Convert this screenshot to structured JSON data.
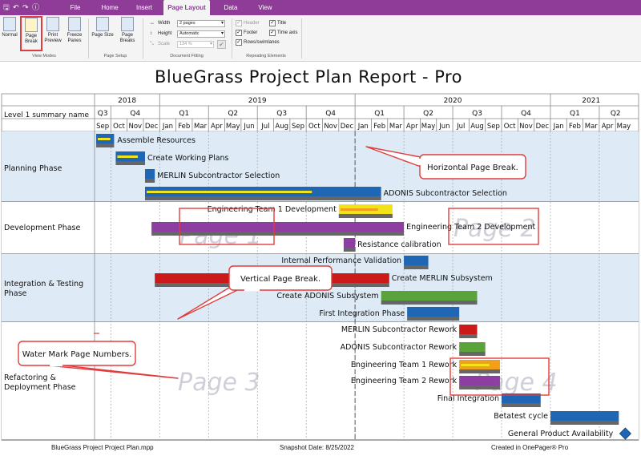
{
  "titlebar": {
    "tabs": [
      "File",
      "Home",
      "Insert",
      "Page Layout",
      "Data",
      "View"
    ],
    "active_tab": "Page Layout"
  },
  "ribbon": {
    "view_modes": {
      "label": "View Modes",
      "normal": "Normal",
      "page_break": "Page Break",
      "print_preview": "Print Preview",
      "freeze_panes": "Freeze Panes"
    },
    "page_setup": {
      "label": "Page Setup",
      "page_size": "Page Size",
      "page_breaks": "Page Breaks"
    },
    "document_fitting": {
      "label": "Document Fitting",
      "width_label": "Width",
      "width_value": "2 pages",
      "height_label": "Height",
      "height_value": "Automatic",
      "scale_label": "Scale",
      "scale_value": "134 %"
    },
    "repeating_elements": {
      "label": "Repeating Elements",
      "header": "Header",
      "footer": "Footer",
      "rows": "Rows/swimlanes",
      "title": "Title",
      "time_axis": "Time axis"
    }
  },
  "report": {
    "title": "BlueGrass Project Plan Report - Pro",
    "corner_label": "Level 1 summary name",
    "years": [
      "2018",
      "2019",
      "2020",
      "2021"
    ],
    "quarters": [
      "Q3",
      "Q4",
      "Q1",
      "Q2",
      "Q3",
      "Q4",
      "Q1",
      "Q2",
      "Q3",
      "Q4",
      "Q1",
      "Q2"
    ],
    "months": [
      "Sep",
      "Oct",
      "Nov",
      "Dec",
      "Jan",
      "Feb",
      "Mar",
      "Apr",
      "May",
      "Jun",
      "Jul",
      "Aug",
      "Sep",
      "Oct",
      "Nov",
      "Dec",
      "Jan",
      "Feb",
      "Mar",
      "Apr",
      "May",
      "Jun",
      "Jul",
      "Aug",
      "Sep",
      "Oct",
      "Nov",
      "Dec",
      "Jan",
      "Feb",
      "Mar",
      "Apr",
      "May"
    ],
    "swimlanes": [
      "Planning Phase",
      "Development Phase",
      "Integration & Testing Phase",
      "Refactoring & Deployment Phase"
    ],
    "tasks": [
      {
        "label": "Assemble Resources"
      },
      {
        "label": "Create Working Plans"
      },
      {
        "label": "MERLIN Subcontractor Selection"
      },
      {
        "label": "ADONIS Subcontractor Selection"
      },
      {
        "label": "Engineering Team 1 Development"
      },
      {
        "label": "Engineering Team 2 Development"
      },
      {
        "label": "Resistance calibration"
      },
      {
        "label": "Internal Performance Validation"
      },
      {
        "label": "Create MERLIN Subsystem"
      },
      {
        "label": "Create ADONIS Subsystem"
      },
      {
        "label": "First Integration Phase"
      },
      {
        "label": "MERLIN Subcontractor Rework"
      },
      {
        "label": "ADONIS Subcontractor Rework"
      },
      {
        "label": "Engineering Team 1 Rework"
      },
      {
        "label": "Engineering Team 2 Rework"
      },
      {
        "label": "Final Integration"
      },
      {
        "label": "Betatest cycle"
      },
      {
        "label": "General Product Availability"
      }
    ],
    "watermarks": [
      "Page 1",
      "Page 2",
      "Page 3",
      "Page 4"
    ],
    "callouts": [
      "Horizontal Page Break.",
      "Vertical Page Break.",
      "Water Mark Page Numbers."
    ],
    "colors": {
      "lane_blue": "#deebf7",
      "bar_blue": "#1f67b4",
      "bar_purple": "#8e3ea0",
      "bar_red": "#cc1a1a",
      "bar_green": "#5aa23a",
      "bar_yellow": "#f2e21a",
      "bar_orange": "#f2a01a",
      "shadow": "#666666",
      "accent_purple": "#8e3c97",
      "callout_red": "#e03c3c",
      "milestone": "#1f67b4"
    }
  },
  "footer": {
    "file": "BlueGrass Project Project Plan.mpp",
    "snapshot": "Snapshot Date: 8/25/2022",
    "created": "Created in OnePager® Pro"
  }
}
